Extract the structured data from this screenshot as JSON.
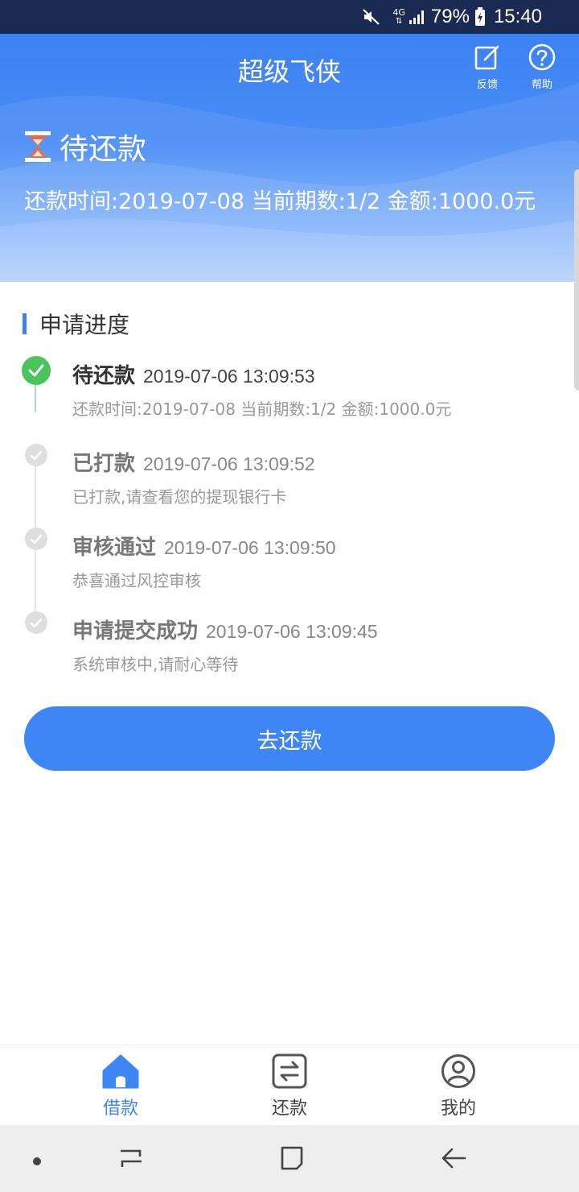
{
  "status_bar": {
    "network": "4G",
    "battery": "79%",
    "time": "15:40"
  },
  "header": {
    "title": "超级飞侠",
    "feedback_label": "反馈",
    "help_label": "帮助"
  },
  "hero": {
    "status": "待还款",
    "summary": "还款时间:2019-07-08 当前期数:1/2 金额:1000.0元"
  },
  "progress": {
    "section_title": "申请进度",
    "steps": [
      {
        "title": "待还款",
        "time": "2019-07-06 13:09:53",
        "desc": "还款时间:2019-07-08 当前期数:1/2 金额:1000.0元"
      },
      {
        "title": "已打款",
        "time": "2019-07-06 13:09:52",
        "desc": "已打款,请查看您的提现银行卡"
      },
      {
        "title": "审核通过",
        "time": "2019-07-06 13:09:50",
        "desc": "恭喜通过风控审核"
      },
      {
        "title": "申请提交成功",
        "time": "2019-07-06 13:09:45",
        "desc": "系统审核中,请耐心等待"
      }
    ]
  },
  "action": {
    "repay_label": "去还款"
  },
  "bottom_nav": {
    "items": [
      {
        "label": "借款",
        "icon": "home-icon",
        "active": true
      },
      {
        "label": "还款",
        "icon": "exchange-icon",
        "active": false
      },
      {
        "label": "我的",
        "icon": "user-icon",
        "active": false
      }
    ]
  },
  "colors": {
    "primary": "#3e85f5",
    "success": "#4bc45c",
    "status_bar": "#1b2a52"
  }
}
